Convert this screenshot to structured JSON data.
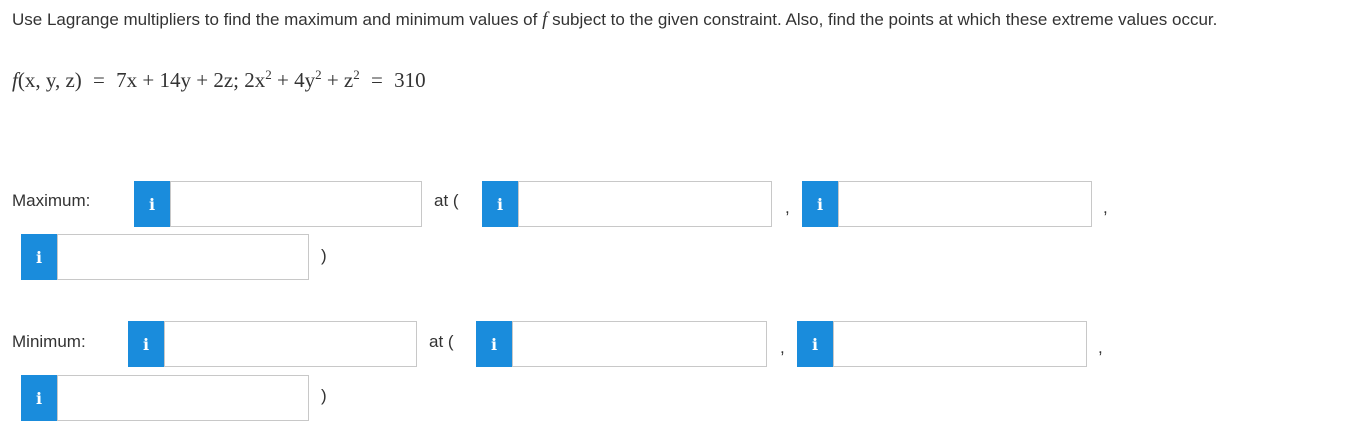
{
  "question": {
    "text_before": "Use Lagrange multipliers to find the maximum and minimum values of",
    "f_symbol": "f",
    "text_after": "subject to the given constraint. Also, find the points at which these extreme values occur.",
    "formula": {
      "f_name": "f",
      "args": "(x, y, z)",
      "eq": "=",
      "expr": "7x + 14y + 2z;",
      "constraint_a": "2x",
      "constraint_b": "+ 4y",
      "constraint_c": "+ z",
      "exp": "2",
      "rhs_eq": "=",
      "rhs": "310"
    }
  },
  "maximum": {
    "label": "Maximum:",
    "at": "at (",
    "comma1": ",",
    "comma2": ",",
    "close": ")",
    "value": "",
    "x": "",
    "y": "",
    "z": ""
  },
  "minimum": {
    "label": "Minimum:",
    "at": "at (",
    "comma1": ",",
    "comma2": ",",
    "close": ")",
    "value": "",
    "x": "",
    "y": "",
    "z": ""
  },
  "info_glyph": "i",
  "icons": {
    "info": "info-icon"
  }
}
